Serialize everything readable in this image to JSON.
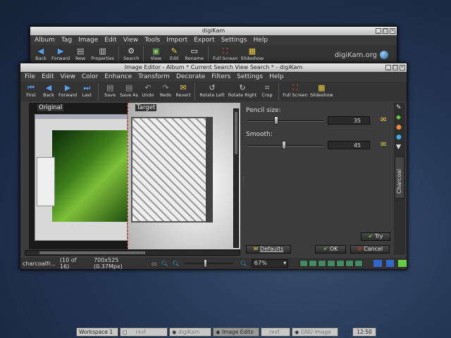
{
  "main_window": {
    "title": "digiKam",
    "menu": [
      "Album",
      "Tag",
      "Image",
      "Edit",
      "View",
      "Tools",
      "Import",
      "Export",
      "Settings",
      "Help"
    ],
    "toolbar": [
      "Back",
      "Forward",
      "New",
      "Properties",
      "Search",
      "View",
      "Edit",
      "Rename",
      "Full Screen",
      "Slideshow"
    ],
    "brand": "digiKam.org"
  },
  "editor": {
    "title": "Image Editor - Album * Current Search View Search * - digiKam",
    "menu": [
      "File",
      "Edit",
      "View",
      "Color",
      "Enhance",
      "Transform",
      "Decorate",
      "Filters",
      "Settings",
      "Help"
    ],
    "toolbar": [
      "First",
      "Back",
      "Forward",
      "Last",
      "Save",
      "Save As",
      "Undo",
      "Redo",
      "Revert",
      "Rotate Left",
      "Rotate Right",
      "Crop",
      "Full Screen",
      "Slideshow"
    ],
    "preview": {
      "original_label": "Original",
      "target_label": "Target"
    },
    "pencil_size_label": "Pencil size:",
    "pencil_size_value": "35",
    "pencil_size_fraction": 0.35,
    "smooth_label": "Smooth:",
    "smooth_value": "45",
    "smooth_fraction": 0.45,
    "side_tab": "Charcoal",
    "buttons": {
      "try": "Try",
      "defaults": "Defaults",
      "ok": "OK",
      "cancel": "Cancel"
    },
    "status": {
      "filename": "charcoalfr...",
      "position": "(10 of 16)",
      "dimensions": "700x525 (0.37Mpx)",
      "zoom": "67%"
    }
  },
  "taskbar": {
    "workspace": "Workspace 1",
    "items": [
      "rxvt",
      "digiKam",
      "Image Edito",
      "rxvt",
      "GNU Image"
    ],
    "clock": "12:50"
  }
}
